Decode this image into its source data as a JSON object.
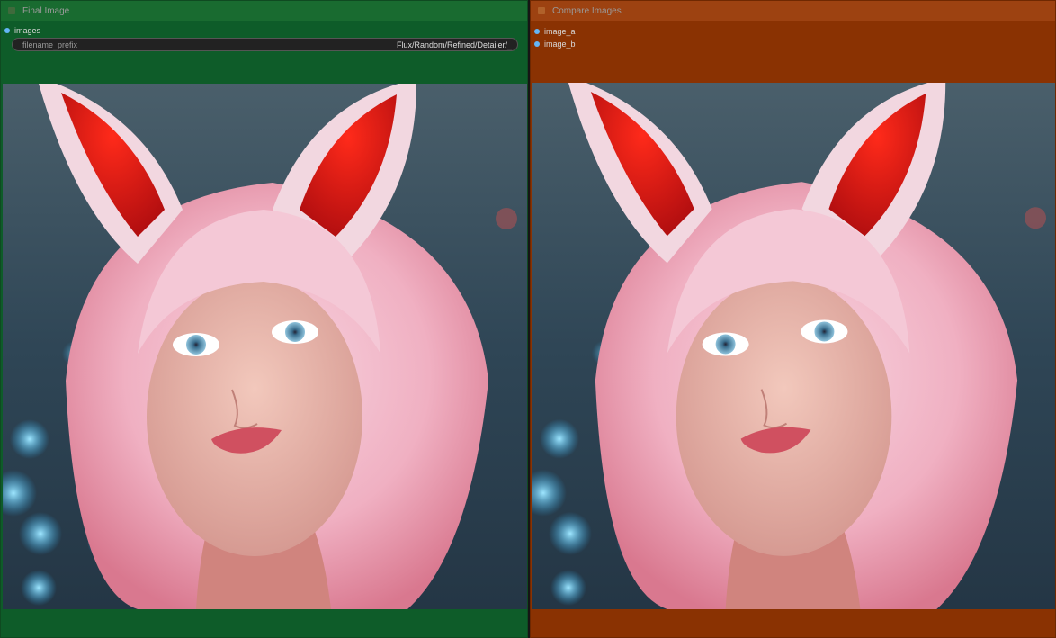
{
  "nodes": {
    "final": {
      "title": "Final Image",
      "input": "images",
      "widget": {
        "name": "filename_prefix",
        "value": "Flux/Random/Refined/Detailer/_"
      },
      "image": {
        "description_icon": "portrait-image"
      }
    },
    "compare": {
      "title": "Compare Images",
      "inputs": [
        "image_a",
        "image_b"
      ],
      "image": {
        "description_icon": "portrait-image"
      }
    }
  },
  "colors": {
    "final_node_bg": "#0e5c29",
    "final_title_bg": "#196b30",
    "compare_node_bg": "#8a3202",
    "compare_title_bg": "#9d4211",
    "slot_dot": "#64b5f6"
  }
}
